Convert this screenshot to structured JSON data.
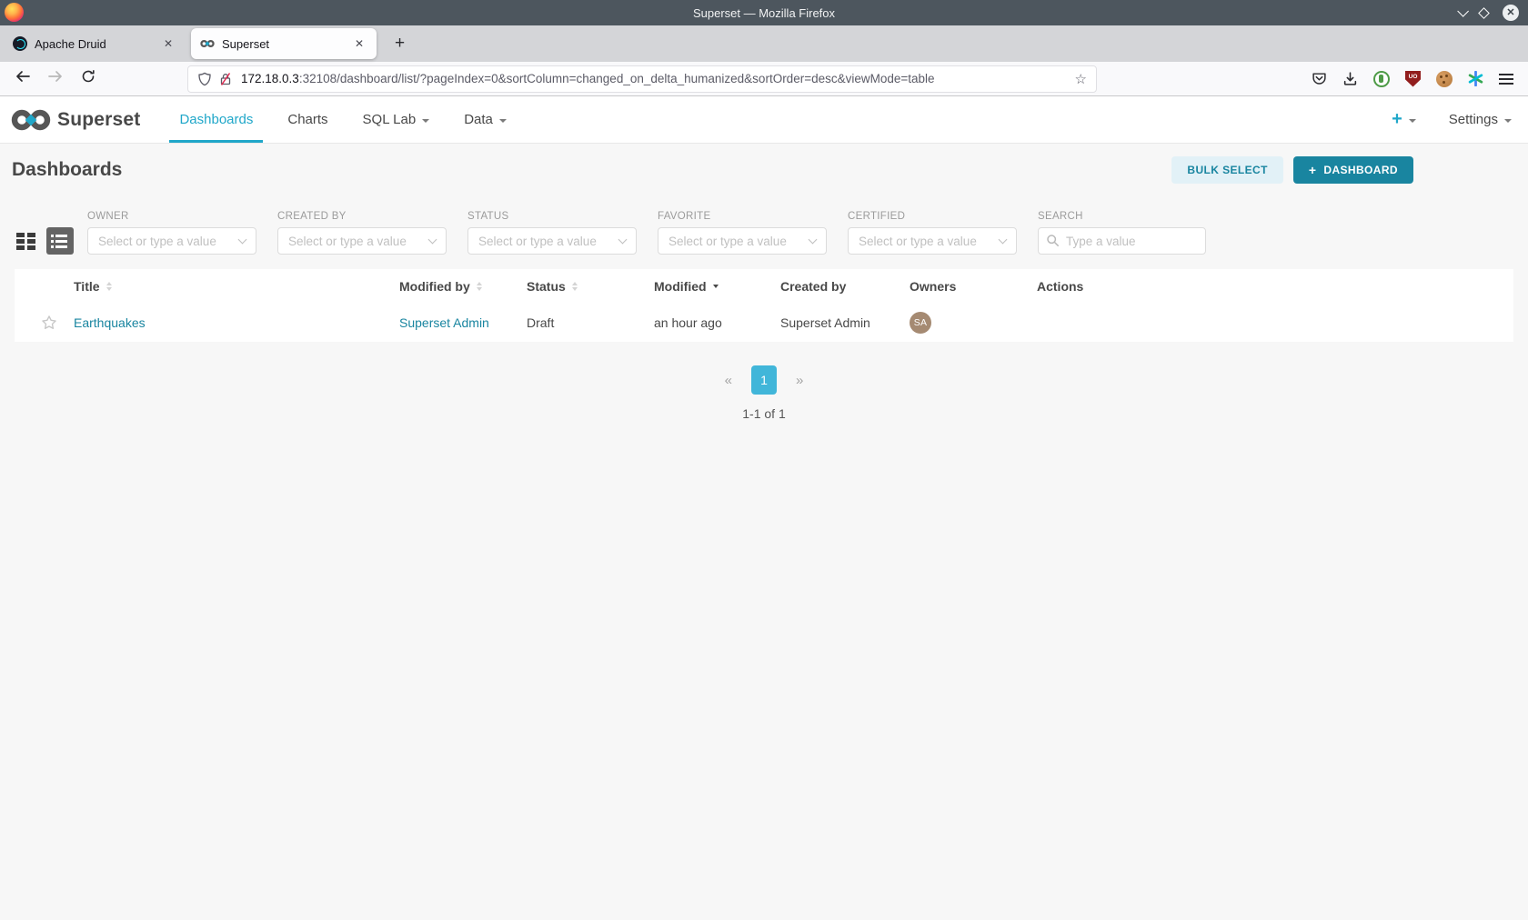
{
  "window": {
    "title": "Superset — Mozilla Firefox",
    "tabs": {
      "tab1": "Apache Druid",
      "tab2": "Superset",
      "close": "✕",
      "new_tab": "+"
    }
  },
  "urlbar": {
    "host": "172.18.0.3",
    "path": ":32108/dashboard/list/?pageIndex=0&sortColumn=changed_on_delta_humanized&sortOrder=desc&viewMode=table",
    "bookmark_star": "☆"
  },
  "navbar": {
    "brand": "Superset",
    "dashboards": "Dashboards",
    "charts": "Charts",
    "sql_lab": "SQL Lab",
    "data": "Data",
    "plus": "+",
    "settings": "Settings"
  },
  "page": {
    "title": "Dashboards",
    "bulk_select": "BULK SELECT",
    "plus": "+",
    "new_dashboard": "DASHBOARD"
  },
  "filters": {
    "owner": {
      "label": "OWNER",
      "placeholder": "Select or type a value"
    },
    "created_by": {
      "label": "CREATED BY",
      "placeholder": "Select or type a value"
    },
    "status": {
      "label": "STATUS",
      "placeholder": "Select or type a value"
    },
    "favorite": {
      "label": "FAVORITE",
      "placeholder": "Select or type a value"
    },
    "certified": {
      "label": "CERTIFIED",
      "placeholder": "Select or type a value"
    },
    "search": {
      "label": "SEARCH",
      "placeholder": "Type a value"
    }
  },
  "table": {
    "columns": {
      "title": "Title",
      "modified_by": "Modified by",
      "status": "Status",
      "modified": "Modified",
      "created_by": "Created by",
      "owners": "Owners",
      "actions": "Actions"
    },
    "row": {
      "title": "Earthquakes",
      "modified_by": "Superset Admin",
      "status": "Draft",
      "modified": "an hour ago",
      "created_by": "Superset Admin",
      "owner_initials": "SA"
    }
  },
  "pagination": {
    "prev": "«",
    "page1": "1",
    "next": "»",
    "summary": "1-1 of 1"
  },
  "colors": {
    "accent": "#20a7c9",
    "accent_dark": "#1985a0",
    "pagination_active": "#41b6d9",
    "avatar_bg": "#a58a72",
    "titlebar_bg": "#4d565e"
  }
}
